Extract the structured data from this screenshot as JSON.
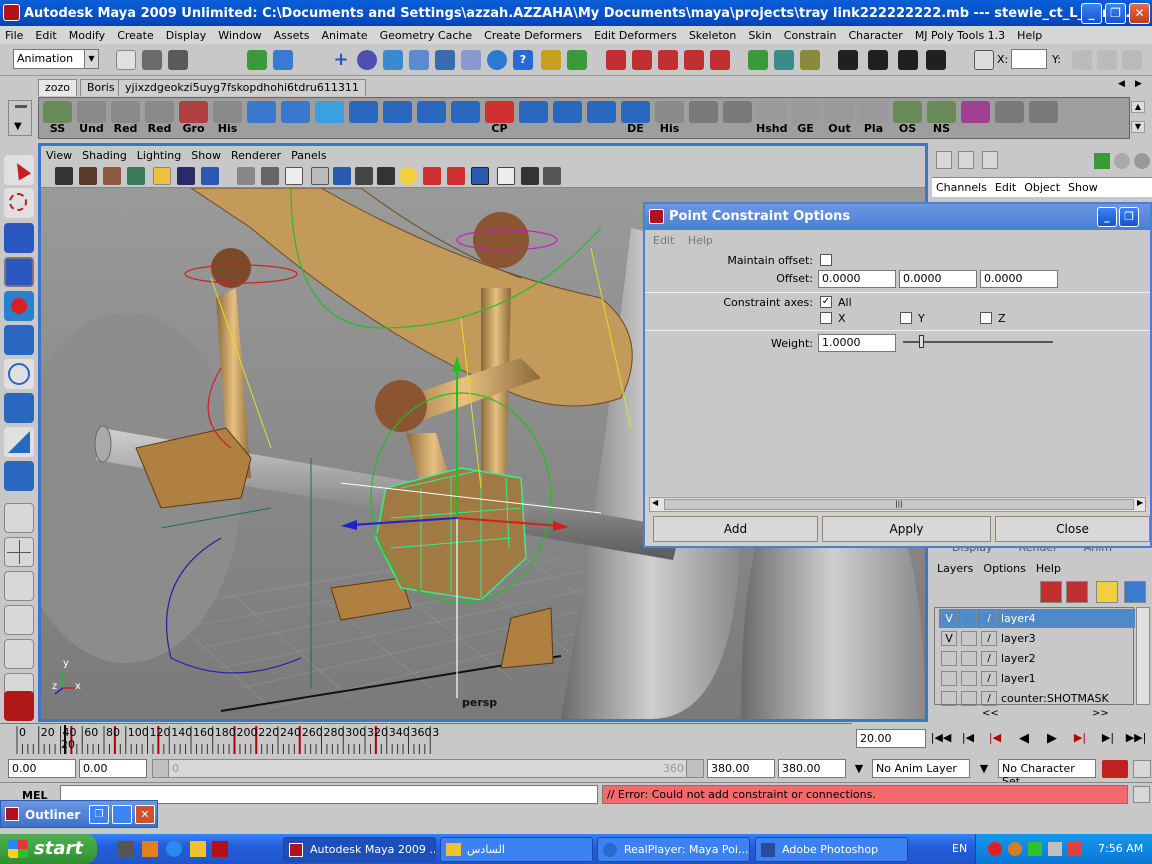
{
  "window": {
    "title": "Autodesk Maya 2009 Unlimited: C:\\Documents and Settings\\azzah.AZZAHA\\My Documents\\maya\\projects\\tray link222222222.mb   ---   stewie_ct_L_hand...",
    "minimize": "_",
    "maximize": "❐",
    "close": "✕"
  },
  "menubar": [
    "File",
    "Edit",
    "Modify",
    "Create",
    "Display",
    "Window",
    "Assets",
    "Animate",
    "Geometry Cache",
    "Create Deformers",
    "Edit Deformers",
    "Skeleton",
    "Skin",
    "Constrain",
    "Character",
    "MJ Poly Tools 1.3",
    "Help"
  ],
  "statusline": {
    "mode": "Animation",
    "x_label": "X:",
    "y_label": "Y:"
  },
  "shelf_tabs": [
    "zozo",
    "Boris",
    "yjixzdgeokzi5uyg7fskopdhohi6tdru611311"
  ],
  "shelf_items": [
    {
      "label": "SS",
      "color": "#6a8a5a"
    },
    {
      "label": "Und",
      "color": "#8a8a8a"
    },
    {
      "label": "Red",
      "color": "#8a8a8a"
    },
    {
      "label": "Red",
      "color": "#8a8a8a"
    },
    {
      "label": "Gro",
      "color": "#b04040"
    },
    {
      "label": "His",
      "color": "#8a8a8a"
    },
    {
      "label": "",
      "color": "#3a78d0"
    },
    {
      "label": "",
      "color": "#3a78d0"
    },
    {
      "label": "",
      "color": "#3aa0e0"
    },
    {
      "label": "",
      "color": "#2a68c0"
    },
    {
      "label": "",
      "color": "#2a68c0"
    },
    {
      "label": "",
      "color": "#2a68c0"
    },
    {
      "label": "",
      "color": "#2a68c0"
    },
    {
      "label": "CP",
      "color": "#d03030"
    },
    {
      "label": "",
      "color": "#2a68c0"
    },
    {
      "label": "",
      "color": "#2a68c0"
    },
    {
      "label": "",
      "color": "#2a68c0"
    },
    {
      "label": "DE",
      "color": "#2a68c0"
    },
    {
      "label": "His",
      "color": "#8a8a8a"
    },
    {
      "label": "",
      "color": "#7a7a7a"
    },
    {
      "label": "",
      "color": "#7a7a7a"
    },
    {
      "label": "Hshd",
      "color": "#9a9a9a"
    },
    {
      "label": "GE",
      "color": "#9a9a9a"
    },
    {
      "label": "Out",
      "color": "#9a9a9a"
    },
    {
      "label": "Pla",
      "color": "#9a9a9a"
    },
    {
      "label": "OS",
      "color": "#6a8a5a"
    },
    {
      "label": "NS",
      "color": "#6a8a5a"
    },
    {
      "label": "",
      "color": "#a04090"
    },
    {
      "label": "",
      "color": "#7a7a7a"
    },
    {
      "label": "",
      "color": "#7a7a7a"
    }
  ],
  "viewport": {
    "menu": [
      "View",
      "Shading",
      "Lighting",
      "Show",
      "Renderer",
      "Panels"
    ],
    "camera_label": "persp",
    "axis_y": "y",
    "axis_z": "z",
    "axis_x": "x"
  },
  "channelbox": {
    "menu": [
      "Channels",
      "Edit",
      "Object",
      "Show"
    ]
  },
  "dialog": {
    "title": "Point Constraint Options",
    "menu": [
      "Edit",
      "Help"
    ],
    "maintain_offset_label": "Maintain offset:",
    "maintain_offset_checked": false,
    "offset_label": "Offset:",
    "offset_values": [
      "0.0000",
      "0.0000",
      "0.0000"
    ],
    "constraint_axes_label": "Constraint axes:",
    "all_label": "All",
    "all_checked": true,
    "x_label": "X",
    "y_label": "Y",
    "z_label": "Z",
    "weight_label": "Weight:",
    "weight_value": "1.0000",
    "scroll_grip": "|||",
    "buttons": {
      "add": "Add",
      "apply": "Apply",
      "close": "Close"
    }
  },
  "layer_editor": {
    "tabs": [
      "Display",
      "Render",
      "Anim"
    ],
    "menu": [
      "Layers",
      "Options",
      "Help"
    ],
    "layers": [
      {
        "v": "V",
        "name": "layer4",
        "selected": true
      },
      {
        "v": "V",
        "name": "layer3",
        "selected": false
      },
      {
        "v": "",
        "name": "layer2",
        "selected": false
      },
      {
        "v": "",
        "name": "layer1",
        "selected": false
      },
      {
        "v": "",
        "name": "counter:SHOTMASK",
        "selected": false
      }
    ],
    "nav_prev": "<<",
    "nav_next": ">>"
  },
  "timeline": {
    "ticks": [
      "0",
      "20",
      "40",
      "60",
      "80",
      "100",
      "120",
      "140",
      "160",
      "180",
      "200",
      "220",
      "240",
      "260",
      "280",
      "300",
      "320",
      "340",
      "360",
      "3"
    ],
    "current_frame_label": "20",
    "current_time": "20.00"
  },
  "range": {
    "start": "0.00",
    "playback_start": "0.00",
    "slider_start": "0",
    "slider_end": "360",
    "playback_end": "380.00",
    "end": "380.00",
    "anim_layer": "No Anim Layer",
    "character_set": "No Character Set"
  },
  "command_line": {
    "label": "MEL",
    "error": "// Error: Could not add constraint or connections."
  },
  "outliner": {
    "title": "Outliner"
  },
  "taskbar": {
    "start": "start",
    "tasks": [
      {
        "label": "Autodesk Maya 2009 ...",
        "active": true
      },
      {
        "label": "السادس",
        "active": false
      },
      {
        "label": "RealPlayer: Maya Poi...",
        "active": false
      },
      {
        "label": "Adobe Photoshop",
        "active": false
      }
    ],
    "language": "EN",
    "clock": "7:56 AM"
  },
  "colors": {
    "accent_blue": "#3d75c9",
    "selection": "#4d8ac7",
    "error_bg": "#f26a6a",
    "timeline_key": "#b00000"
  }
}
